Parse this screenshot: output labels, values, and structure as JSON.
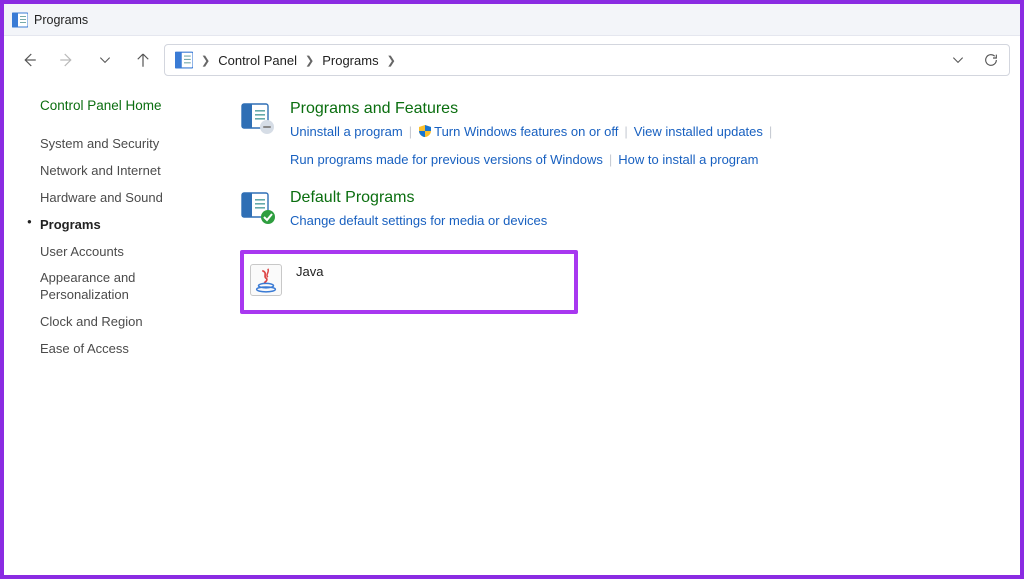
{
  "window": {
    "title": "Programs"
  },
  "breadcrumbs": {
    "root": "Control Panel",
    "current": "Programs"
  },
  "sidebar": {
    "home": "Control Panel Home",
    "items": [
      {
        "label": "System and Security",
        "active": false
      },
      {
        "label": "Network and Internet",
        "active": false
      },
      {
        "label": "Hardware and Sound",
        "active": false
      },
      {
        "label": "Programs",
        "active": true
      },
      {
        "label": "User Accounts",
        "active": false
      },
      {
        "label": "Appearance and Personalization",
        "active": false
      },
      {
        "label": "Clock and Region",
        "active": false
      },
      {
        "label": "Ease of Access",
        "active": false
      }
    ]
  },
  "categories": {
    "programs_features": {
      "title": "Programs and Features",
      "links": {
        "uninstall": "Uninstall a program",
        "turn_features": "Turn Windows features on or off",
        "view_updates": "View installed updates",
        "run_compat": "Run programs made for previous versions of Windows",
        "how_install": "How to install a program"
      }
    },
    "default_programs": {
      "title": "Default Programs",
      "link": "Change default settings for media or devices"
    },
    "java": {
      "title": "Java"
    }
  },
  "highlight_color": "#a838f0"
}
